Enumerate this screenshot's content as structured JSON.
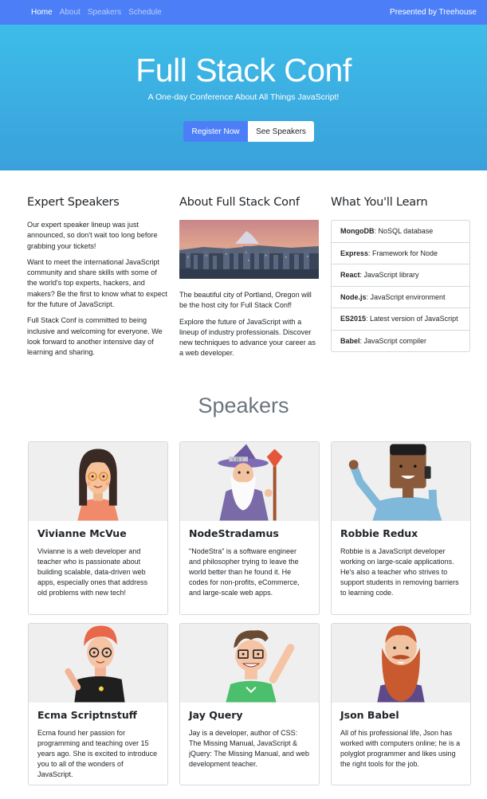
{
  "nav": {
    "links": [
      "Home",
      "About",
      "Speakers",
      "Schedule"
    ],
    "brand": "Presented by Treehouse"
  },
  "hero": {
    "title": "Full Stack Conf",
    "subtitle": "A One-day Conference About All Things JavaScript!",
    "primary_button": "Register Now",
    "secondary_button": "See Speakers"
  },
  "expert": {
    "heading": "Expert Speakers",
    "paragraphs": [
      "Our expert speaker lineup was just announced, so don't wait too long before grabbing your tickets!",
      "Want to meet the international JavaScript community and share skills with some of the world's top experts, hackers, and makers? Be the first to know what to expect for the future of JavaScript.",
      "Full Stack Conf is committed to being inclusive and welcoming for everyone. We look forward to another intensive day of learning and sharing."
    ]
  },
  "about": {
    "heading": "About Full Stack Conf",
    "paragraphs": [
      "The beautiful city of Portland, Oregon will be the host city for Full Stack Conf!",
      "Explore the future of JavaScript with a lineup of industry professionals. Discover new techniques to advance your career as a web developer."
    ]
  },
  "learn": {
    "heading": "What You'll Learn",
    "items": [
      {
        "term": "MongoDB",
        "desc": ": NoSQL database"
      },
      {
        "term": "Express",
        "desc": ": Framework for Node"
      },
      {
        "term": "React",
        "desc": ": JavaScript library"
      },
      {
        "term": "Node.js",
        "desc": ": JavaScript environment"
      },
      {
        "term": "ES2015",
        "desc": ": Latest version of JavaScript"
      },
      {
        "term": "Babel",
        "desc": ": JavaScript compiler"
      }
    ]
  },
  "speakers": {
    "heading": "Speakers",
    "cards": [
      {
        "name": "Vivianne McVue",
        "bio": "Vivianne is a web developer and teacher who is passionate about building scalable, data-driven web apps, especially ones that address old problems with new tech!"
      },
      {
        "name": "NodeStradamus",
        "bio": "\"NodeStra\" is a software engineer and philosopher trying to leave the world better than he found it. He codes for non-profits, eCommerce, and large-scale web apps."
      },
      {
        "name": "Robbie Redux",
        "bio": "Robbie is a JavaScript developer working on large-scale applications. He's also a teacher who strives to support students in removing barriers to learning code."
      },
      {
        "name": "Ecma Scriptnstuff",
        "bio": "Ecma found her passion for programming and teaching over 15 years ago. She is excited to introduce you to all of the wonders of JavaScript."
      },
      {
        "name": "Jay Query",
        "bio": "Jay is a developer, author of CSS: The Missing Manual, JavaScript & jQuery: The Missing Manual, and web development teacher."
      },
      {
        "name": "Json Babel",
        "bio": "All of his professional life, Json has worked with computers online; he is a polyglot programmer and likes using the right tools for the job."
      }
    ]
  },
  "colors": {
    "primary": "#4c7ff7",
    "hero_top": "#3dbde8",
    "hero_bottom": "#3aa0db",
    "muted": "#6c757d"
  }
}
